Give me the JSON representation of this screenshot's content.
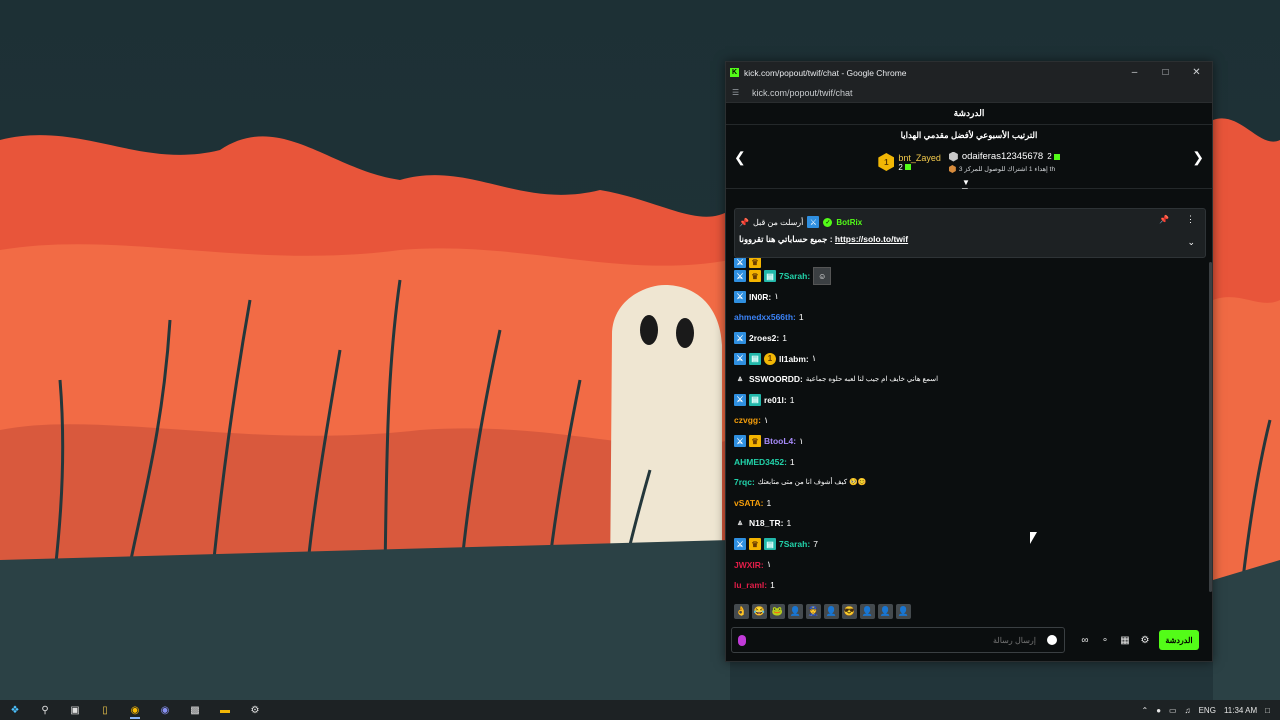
{
  "browser": {
    "window_title": "kick.com/popout/twif/chat - Google Chrome",
    "favicon_letter": "K",
    "url": "kick.com/popout/twif/chat"
  },
  "chat": {
    "header_title": "الدردشة",
    "leaderboard": {
      "title": "الترتيب الأسبوعي لأفضل مقدمي الهدايا",
      "first": {
        "rank": "1",
        "name": "bnt_Zayed",
        "count": "2"
      },
      "second": {
        "name": "odaiferas12345678",
        "count": "2",
        "subtitle": "إهداء 1 اشتراك للوصول للمركز 3 th"
      }
    },
    "pinned": {
      "pinned_label": "أرسلت من قبل",
      "bot_name": "BotRix",
      "message_prefix": "جميع حساباتي هنا تقروونا :",
      "link": "https://solo.to/twif"
    },
    "messages": [
      {
        "user": "",
        "color": "#22d3aa",
        "text": "",
        "badges": [
          "mod",
          "vip"
        ],
        "partial": true
      },
      {
        "user": "7Sarah:",
        "color": "#22d3aa",
        "text": "",
        "badges": [
          "mod",
          "vip",
          "sub"
        ],
        "avatar": true
      },
      {
        "user": "IN0R:",
        "color": "#ffffff",
        "text": "١",
        "badges": [
          "mod"
        ]
      },
      {
        "user": "ahmedxx566th:",
        "color": "#3b82f6",
        "text": "1",
        "badges": []
      },
      {
        "user": "2roes2:",
        "color": "#ffffff",
        "text": "1",
        "badges": [
          "mod"
        ]
      },
      {
        "user": "ll1abm:",
        "color": "#ffffff",
        "text": "١",
        "badges": [
          "mod",
          "sub",
          "gold"
        ]
      },
      {
        "user": "SSWOORDD:",
        "color": "#ffffff",
        "text": "اسمع هاني خايف ام جيب لنا لعبه حلوه جماعية",
        "badges": [
          "og"
        ],
        "small": true
      },
      {
        "user": "re01l:",
        "color": "#ffffff",
        "text": "1",
        "badges": [
          "mod",
          "sub"
        ]
      },
      {
        "user": "czvgg:",
        "color": "#f59e0b",
        "text": "١",
        "badges": []
      },
      {
        "user": "BtooL4:",
        "color": "#a78bfa",
        "text": "١",
        "badges": [
          "mod",
          "vip"
        ]
      },
      {
        "user": "AHMED3452:",
        "color": "#22d3aa",
        "text": "1",
        "badges": []
      },
      {
        "user": "7rqc:",
        "color": "#22d3aa",
        "text": "كيف أشوف انا من متى متابعتك 🥺😊",
        "badges": [],
        "small": true
      },
      {
        "user": "vSATA:",
        "color": "#f59e0b",
        "text": "1",
        "badges": []
      },
      {
        "user": "N18_TR:",
        "color": "#ffffff",
        "text": "1",
        "badges": [
          "og"
        ]
      },
      {
        "user": "7Sarah:",
        "color": "#22d3aa",
        "text": "7",
        "badges": [
          "mod",
          "vip",
          "sub"
        ]
      },
      {
        "user": "JWXIR:",
        "color": "#e11d48",
        "text": "١",
        "badges": []
      },
      {
        "user": "lu_ramI:",
        "color": "#e11d48",
        "text": "1",
        "badges": []
      }
    ],
    "input": {
      "placeholder": "إرسال رسالة"
    },
    "send_label": "الدردشة"
  },
  "taskbar": {
    "language": "ENG",
    "time": "11:34 AM"
  },
  "colors": {
    "kick_green": "#53fc18",
    "accent_blue": "#2f8fe0"
  },
  "icons": [
    "windows-start-icon",
    "search-icon",
    "task-view-icon",
    "file-explorer-icon",
    "chrome-icon",
    "discord-icon",
    "app-icon",
    "kick-icon",
    "settings-icon"
  ]
}
